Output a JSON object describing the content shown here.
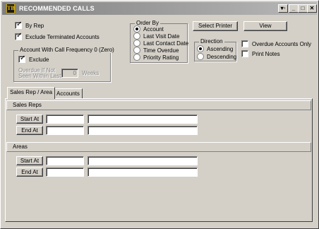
{
  "window": {
    "title": "RECOMMENDED CALLS",
    "app_icon": "TB",
    "controls": {
      "restore": "▾▫",
      "minimize": "_",
      "maximize": "□",
      "close": "✕"
    }
  },
  "options": {
    "by_rep": {
      "label": "By Rep",
      "checked": true
    },
    "exclude_terminated": {
      "label": "Exclude Terminated Accounts",
      "checked": true
    }
  },
  "call_frequency": {
    "title": "Account With Call Frequency 0 (Zero)",
    "exclude": {
      "label": "Exclude",
      "checked": true
    },
    "overdue_label_1": "Overdue If Not",
    "overdue_label_2": "Seen Within Last",
    "weeks_value": "0",
    "weeks_label": "Weeks"
  },
  "order_by": {
    "title": "Order By",
    "options": [
      {
        "label": "Account",
        "selected": true
      },
      {
        "label": "Last Visit Date",
        "selected": false
      },
      {
        "label": "Last Contact Date",
        "selected": false
      },
      {
        "label": "Time Overdue",
        "selected": false
      },
      {
        "label": "Priority Rating",
        "selected": false
      }
    ]
  },
  "buttons": {
    "select_printer": "Select Printer",
    "view": "View"
  },
  "direction": {
    "title": "Direction",
    "options": [
      {
        "label": "Ascending",
        "selected": true
      },
      {
        "label": "Descending",
        "selected": false
      }
    ]
  },
  "flags": {
    "overdue_only": {
      "label": "Overdue Accounts Only",
      "checked": false
    },
    "print_notes": {
      "label": "Print Notes",
      "checked": false
    }
  },
  "tabs": [
    {
      "label": "Sales Rep / Area",
      "active": true
    },
    {
      "label": "Accounts",
      "active": false
    }
  ],
  "sales_reps": {
    "header": "Sales Reps",
    "start_label": "Start At",
    "end_label": "End At",
    "start_code": "",
    "start_name": "",
    "end_code": "",
    "end_name": ""
  },
  "areas": {
    "header": "Areas",
    "start_label": "Start At",
    "end_label": "End At",
    "start_code": "",
    "start_name": "",
    "end_code": "",
    "end_name": ""
  }
}
